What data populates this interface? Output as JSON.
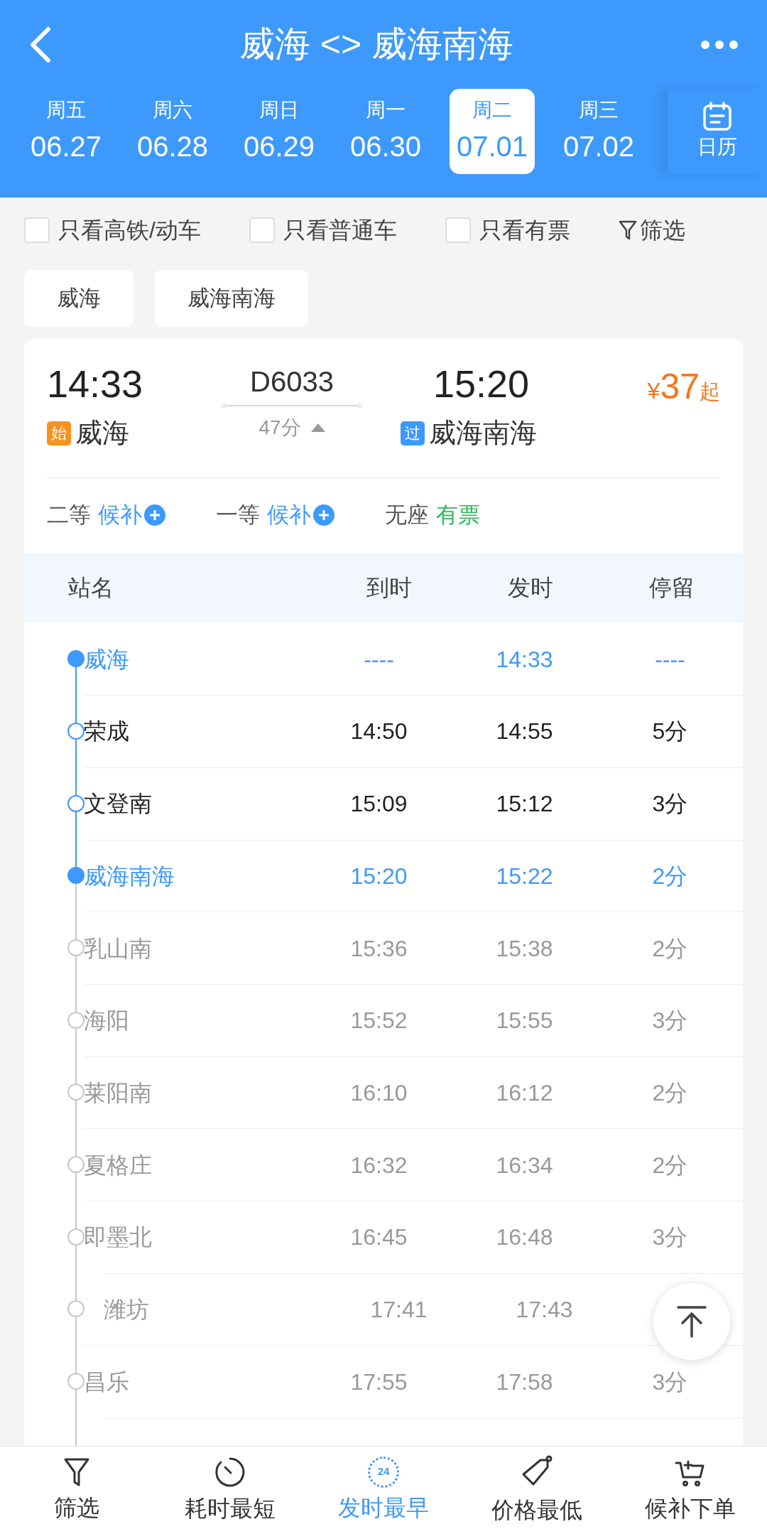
{
  "header": {
    "title": "威海 <> 威海南海"
  },
  "dates": [
    {
      "weekday": "周五",
      "date": "06.27",
      "selected": false
    },
    {
      "weekday": "周六",
      "date": "06.28",
      "selected": false
    },
    {
      "weekday": "周日",
      "date": "06.29",
      "selected": false
    },
    {
      "weekday": "周一",
      "date": "06.30",
      "selected": false
    },
    {
      "weekday": "周二",
      "date": "07.01",
      "selected": true
    },
    {
      "weekday": "周三",
      "date": "07.02",
      "selected": false
    }
  ],
  "calendar_label": "日历",
  "filters": [
    {
      "label": "只看高铁/动车",
      "checked": false
    },
    {
      "label": "只看普通车",
      "checked": false
    },
    {
      "label": "只看有票",
      "checked": false
    }
  ],
  "filter_button": "筛选",
  "station_chips": [
    "威海",
    "威海南海"
  ],
  "train": {
    "depart_time": "14:33",
    "number": "D6033",
    "arrive_time": "15:20",
    "price_symbol": "¥",
    "price": "37",
    "price_suffix": "起",
    "from_tag": "始",
    "from": "威海",
    "duration": "47分",
    "expanded": true,
    "to_tag": "过",
    "to": "威海南海",
    "seats": [
      {
        "class": "二等",
        "status": "候补",
        "kind": "waitlist"
      },
      {
        "class": "一等",
        "status": "候补",
        "kind": "waitlist"
      },
      {
        "class": "无座",
        "status": "有票",
        "kind": "available"
      }
    ]
  },
  "stops_table": {
    "columns": [
      "站名",
      "到时",
      "发时",
      "停留"
    ],
    "rows": [
      {
        "station": "威海",
        "arrive": "----",
        "depart": "14:33",
        "stop": "----",
        "kind": "endpoint"
      },
      {
        "station": "荣成",
        "arrive": "14:50",
        "depart": "14:55",
        "stop": "5分",
        "kind": "segment"
      },
      {
        "station": "文登南",
        "arrive": "15:09",
        "depart": "15:12",
        "stop": "3分",
        "kind": "segment"
      },
      {
        "station": "威海南海",
        "arrive": "15:20",
        "depart": "15:22",
        "stop": "2分",
        "kind": "endpoint"
      },
      {
        "station": "乳山南",
        "arrive": "15:36",
        "depart": "15:38",
        "stop": "2分",
        "kind": "outside"
      },
      {
        "station": "海阳",
        "arrive": "15:52",
        "depart": "15:55",
        "stop": "3分",
        "kind": "outside"
      },
      {
        "station": "莱阳南",
        "arrive": "16:10",
        "depart": "16:12",
        "stop": "2分",
        "kind": "outside"
      },
      {
        "station": "夏格庄",
        "arrive": "16:32",
        "depart": "16:34",
        "stop": "2分",
        "kind": "outside"
      },
      {
        "station": "即墨北",
        "arrive": "16:45",
        "depart": "16:48",
        "stop": "3分",
        "kind": "outside"
      },
      {
        "station": "潍坊",
        "arrive": "17:41",
        "depart": "17:43",
        "kind": "outside"
      },
      {
        "station": "昌乐",
        "arrive": "17:55",
        "depart": "17:58",
        "stop": "3分",
        "kind": "outside"
      }
    ]
  },
  "bottom_nav": [
    {
      "label": "筛选",
      "kind": "filter",
      "selected": false
    },
    {
      "label": "耗时最短",
      "kind": "timer",
      "selected": false
    },
    {
      "label": "发时最早",
      "kind": "clock24",
      "badge": "24",
      "selected": true
    },
    {
      "label": "价格最低",
      "kind": "tag",
      "selected": false
    },
    {
      "label": "候补下单",
      "kind": "cart",
      "selected": false
    }
  ]
}
